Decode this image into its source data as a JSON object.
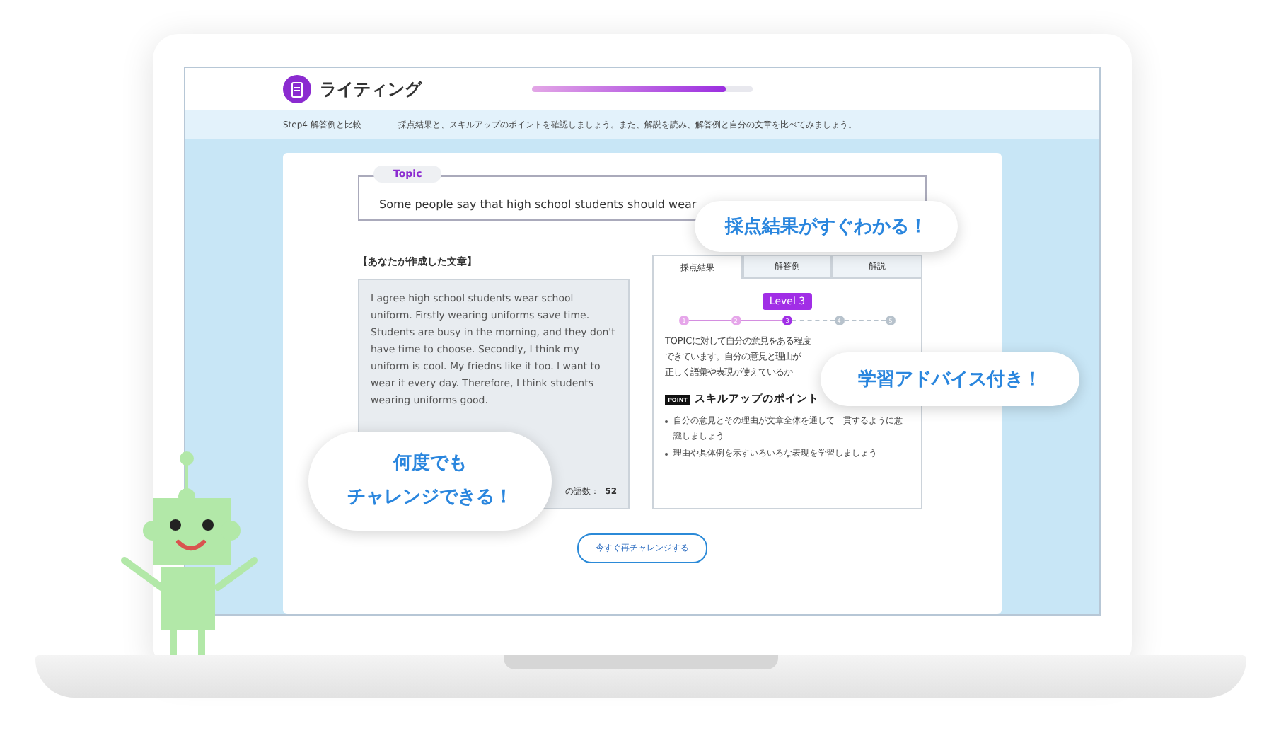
{
  "app": {
    "title": "ライティング",
    "progress": {
      "level": 0.88
    }
  },
  "step": {
    "label": "Step4 解答例と比較",
    "instruction": "採点結果と、スキルアップのポイントを確認しましょう。また、解説を読み、解答例と自分の文章を比べてみましょう。"
  },
  "topic": {
    "label": "Topic",
    "text": "Some people say that high school students should wear"
  },
  "essay": {
    "heading": "【あなたが作成した文章】",
    "text": "I agree high school students wear school uniform. Firstly wearing uniforms save time. Students are busy in the morning, and they don't have time to choose. Secondly, I think my uniform is cool. My friedns like it too. I want to wear it every day. Therefore, I think students wearing uniforms good.",
    "word_count_label": "の語数：",
    "word_count": "52"
  },
  "tabs": [
    {
      "label": "採点結果",
      "selected": true
    },
    {
      "label": "解答例",
      "selected": false
    },
    {
      "label": "解説",
      "selected": false
    }
  ],
  "result": {
    "level_label": "Level 3",
    "steps": [
      {
        "label": "1",
        "reached": true,
        "selected": false
      },
      {
        "label": "2",
        "reached": true,
        "selected": false
      },
      {
        "label": "3",
        "reached": true,
        "selected": true
      },
      {
        "label": "4",
        "reached": false,
        "selected": false
      },
      {
        "label": "5",
        "reached": false,
        "selected": false
      }
    ],
    "comment_lines": [
      "TOPICに対して自分の意見をある程度",
      "できています。自分の意見と理由が",
      "正しく語彙や表現が使えているか"
    ],
    "point_badge": "POINT",
    "point_title": "スキルアップのポイント",
    "points": [
      "自分の意見とその理由が文章全体を通して一貫するように意識しましょう",
      "理由や具体例を示すいろいろな表現を学習しましょう"
    ]
  },
  "retry_button": "今すぐ再チャレンジする",
  "callouts": [
    {
      "kind": "top",
      "lines": [
        "採点結果がすぐわかる！"
      ]
    },
    {
      "kind": "right",
      "lines": [
        "学習アドバイス付き！"
      ]
    },
    {
      "kind": "left",
      "lines": [
        "何度でも",
        "チャレンジできる！"
      ]
    }
  ]
}
